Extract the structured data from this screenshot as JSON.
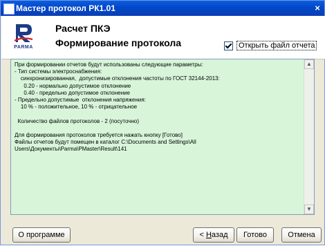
{
  "window": {
    "title": "Мастер протокол РК1.01",
    "close_glyph": "×"
  },
  "header": {
    "logo_text": "PARMA",
    "title": "Расчет ПКЭ",
    "subtitle": "Формирование протокола",
    "open_report_checkbox": {
      "label": "Открыть файл отчета",
      "checked": true
    }
  },
  "report_text": "При формировании отчетов будут использованы следующие параметры:\n- Тип системы электроснабжения:\n    синхронизированная,  допустимые отклонения частоты по ГОСТ 32144-2013:\n      0.20 - нормально допустимое отклонение\n      0.40 - предельно допустимое отклонение\n- Предельно допустимые  отклонения напряжения:\n    10 % - положительное, 10 % - отрицательное\n\n  Количество файлов протоколов - 2 (посуточно)\n\nДля формирования протоколов требуется нажать кнопку [Готово]\nФайлы отчетов будут помещен в каталог C:\\Documents and Settings\\All\nUsers\\Документы\\Parma\\PMaster\\Result\\141",
  "buttons": {
    "about": "О программе",
    "back_prefix": "< ",
    "back_hotkey": "Н",
    "back_rest": "азад",
    "finish": "Готово",
    "cancel": "Отмена"
  },
  "colors": {
    "text_area_bg": "#d8f5da",
    "titlebar": "#0347c8",
    "logo": "#1d3a86"
  }
}
